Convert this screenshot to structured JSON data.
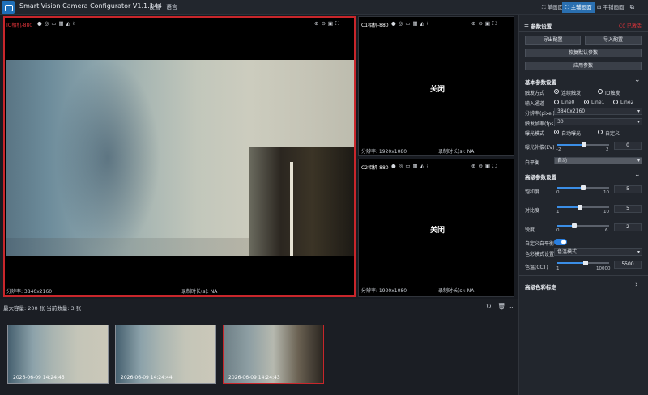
{
  "app": {
    "title": "Smart Vision Camera Configurator V1.1.144",
    "menu": [
      "设置",
      "语言"
    ],
    "view_tabs": [
      "单画面",
      "主辅画面",
      "平铺画面"
    ],
    "active_view_tab": "主辅画面",
    "window_buttons": [
      "⧉",
      "—",
      "✕"
    ]
  },
  "cameras": {
    "main": {
      "title": "IO相机-880",
      "title_color": "#e0343a",
      "resolution": "分辨率: 3840x2160",
      "record": "录制时长(s): NA"
    },
    "c1": {
      "title": "C1相机-880",
      "status": "关闭",
      "resolution": "分辨率: 1920x1080",
      "record": "录制时长(s): NA"
    },
    "c2": {
      "title": "C2相机-880",
      "status": "关闭",
      "resolution": "分辨率: 1920x1080",
      "record": "录制时长(s): NA"
    }
  },
  "thumbnails": {
    "capacity_text": "最大容量: 200 张 当前数量: 3 张",
    "items": [
      {
        "timestamp": "2026-06-09 14:24:45"
      },
      {
        "timestamp": "2026-06-09 14:24:44"
      },
      {
        "timestamp": "2026-06-09 14:24:43"
      }
    ]
  },
  "settings": {
    "header": "参数设置",
    "camera_status": "C0 已激活",
    "status_color": "#e0343a",
    "export_btn": "导出配置",
    "import_btn": "导入配置",
    "restore_btn": "恢复默认参数",
    "apply_btn": "应用参数",
    "basic_section": "基本参数设置",
    "trigger_label": "触发方式",
    "trigger_options": [
      "连续触发",
      "IO触发"
    ],
    "input_label": "输入通道",
    "input_options": [
      "Line0",
      "Line1",
      "Line2"
    ],
    "resolution_label": "分辨率(pixel)",
    "resolution_value": "3840x2160",
    "framerate_label": "触发帧率(fps)",
    "framerate_value": "30",
    "exposure_mode_label": "曝光模式",
    "exposure_mode_options": [
      "自动曝光",
      "自定义"
    ],
    "ev_label": "曝光补偿(EV)",
    "ev_min": "-2",
    "ev_max": "2",
    "ev_value": "0",
    "wb_label": "白平衡",
    "wb_value": "自动",
    "advanced_section": "高级参数设置",
    "saturation_label": "饱和度",
    "saturation_min": "0",
    "saturation_max": "10",
    "saturation_value": "5",
    "contrast_label": "对比度",
    "contrast_min": "1",
    "contrast_max": "10",
    "contrast_value": "5",
    "sharpness_label": "锐度",
    "sharpness_min": "0",
    "sharpness_max": "6",
    "sharpness_value": "2",
    "custom_wb_label": "自定义白平衡",
    "color_mode_label": "色彩模式设置",
    "color_mode_value": "色温模式",
    "cct_label": "色温(CCT)",
    "cct_min": "1",
    "cct_max": "10000",
    "cct_value": "5500",
    "calib_section": "高级色彩标定"
  }
}
